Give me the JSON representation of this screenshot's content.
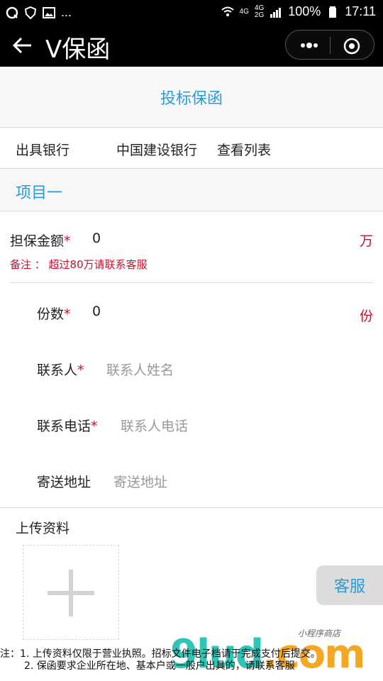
{
  "status_bar": {
    "network1": "4G",
    "network2": "4G",
    "network3": "2G",
    "battery": "100%",
    "time": "17:11",
    "ellipsis": "..."
  },
  "nav": {
    "title": "V保函",
    "back_icon": "arrow-left-icon",
    "more_icon": "more-dots-icon",
    "close_icon": "target-circle-icon"
  },
  "form": {
    "header": "投标保函",
    "bank": {
      "label": "出具银行",
      "value": "中国建设银行",
      "link": "查看列表"
    },
    "project": "项目一",
    "amount": {
      "label": "担保金额",
      "required": "*",
      "value": "0",
      "unit": "万"
    },
    "note": "备注 ： 超过80万请联系客服",
    "copies": {
      "label": "份数",
      "required": "*",
      "value": "0",
      "unit": "份"
    },
    "contact": {
      "label": "联系人",
      "required": "*",
      "placeholder": "联系人姓名"
    },
    "phone": {
      "label": "联系电话",
      "required": "*",
      "placeholder": "联系人电话"
    },
    "address": {
      "label": "寄送地址",
      "placeholder": "寄送地址"
    },
    "upload_label": "上传资料",
    "service_button": "客服",
    "footnote_line1": "注：1. 上传资料仅限于营业执照。招标文件电子档请于完成支付后提交。",
    "footnote_line2": "2. 保函要求企业所在地、基本户或一般户出具的，请联系客服"
  },
  "watermark": {
    "brand": "9lud",
    "suffix": ".com",
    "tagline": "小程序商店"
  },
  "colors": {
    "accent": "#2a9bd6",
    "required": "#c8102e",
    "nav_bg": "#000000"
  }
}
